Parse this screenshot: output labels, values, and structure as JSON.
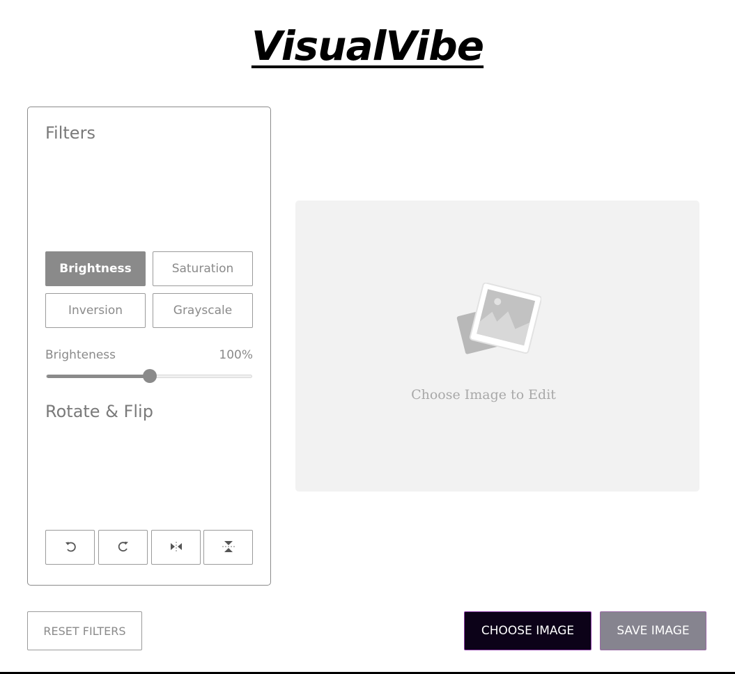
{
  "app": {
    "title": "VisualVibe"
  },
  "filters": {
    "title": "Filters",
    "options": [
      {
        "label": "Brightness",
        "active": true
      },
      {
        "label": "Saturation",
        "active": false
      },
      {
        "label": "Inversion",
        "active": false
      },
      {
        "label": "Grayscale",
        "active": false
      }
    ],
    "slider": {
      "label": "Brighteness",
      "value_text": "100%",
      "fill_fraction": 0.5
    }
  },
  "rotate_flip": {
    "title": "Rotate & Flip",
    "buttons": [
      {
        "icon": "rotate-left-icon"
      },
      {
        "icon": "rotate-right-icon"
      },
      {
        "icon": "flip-horizontal-icon"
      },
      {
        "icon": "flip-vertical-icon"
      }
    ]
  },
  "preview": {
    "placeholder": "Choose Image to Edit",
    "icon": "image-placeholder-icon"
  },
  "actions": {
    "reset_label": "RESET FILTERS",
    "choose_label": "CHOOSE IMAGE",
    "save_label": "SAVE IMAGE"
  },
  "colors": {
    "accent_gray": "#8a8a8a",
    "choose_bg": "#0c0218",
    "save_bg": "#86848f",
    "preview_bg": "#f2f2f2"
  }
}
